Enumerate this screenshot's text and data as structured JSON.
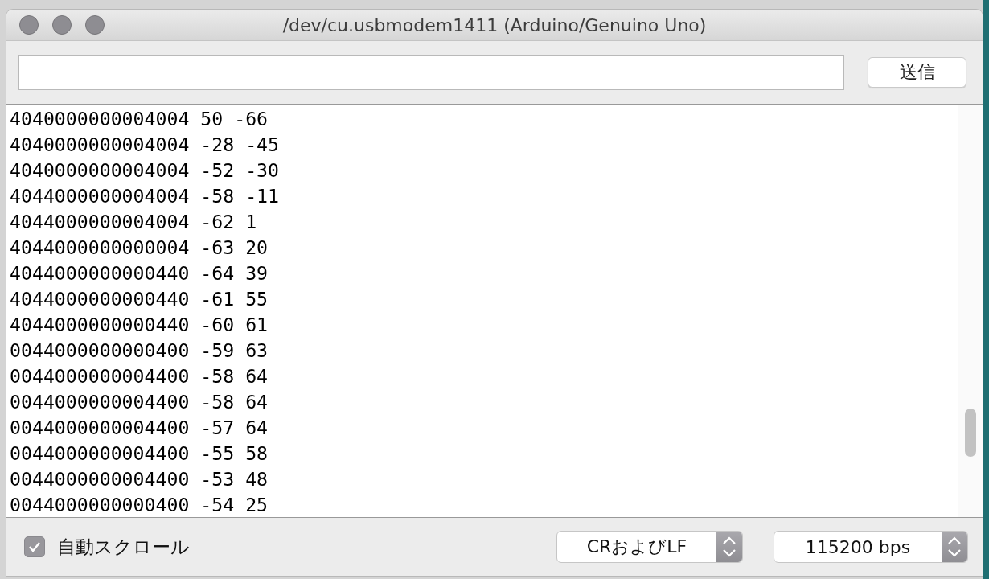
{
  "window": {
    "title": "/dev/cu.usbmodem1411 (Arduino/Genuino Uno)"
  },
  "send_bar": {
    "send_button": "送信"
  },
  "output_lines": [
    "4040000000004004 50 -66",
    "4040000000004004 -28 -45",
    "4040000000004004 -52 -30",
    "4044000000004004 -58 -11",
    "4044000000004004 -62 1",
    "4044000000000004 -63 20",
    "4044000000000440 -64 39",
    "4044000000000440 -61 55",
    "4044000000000440 -60 61",
    "0044000000000400 -59 63",
    "0044000000004400 -58 64",
    "0044000000004400 -58 64",
    "0044000000004400 -57 64",
    "0044000000004400 -55 58",
    "0044000000004400 -53 48",
    "0044000000000400 -54 25"
  ],
  "footer": {
    "autoscroll": {
      "label": "自動スクロール",
      "checked": true
    },
    "line_ending": {
      "value": "CRおよびLF"
    },
    "baud_rate": {
      "value": "115200 bps"
    }
  }
}
